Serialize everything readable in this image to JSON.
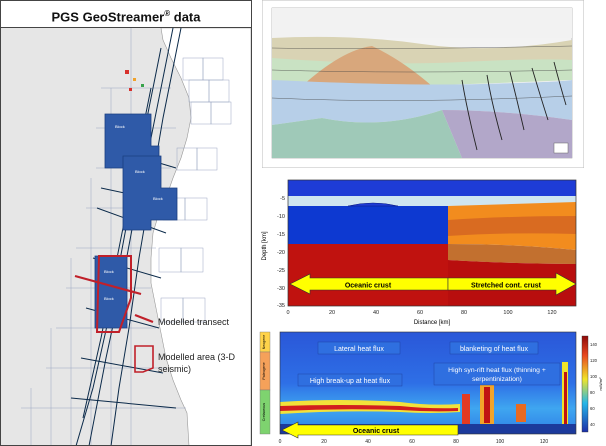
{
  "map": {
    "title_main": "PGS GeoStreamer",
    "title_sup": "®",
    "title_suffix": " data",
    "legend": {
      "transect": "Modelled transect",
      "area": "Modelled area (3-D seismic)"
    },
    "colors": {
      "blocks": "#2f5aa8",
      "transect": "#c0202a",
      "land": "#ffffff",
      "sea": "#e6e6e6",
      "lines": "#0b2a4a"
    }
  },
  "model": {
    "axis_x_label": "Distance [km]",
    "axis_y_label": "Depth [km]",
    "x_ticks": [
      "0",
      "20",
      "40",
      "60",
      "80",
      "100",
      "120"
    ],
    "y_ticks": [
      "-5",
      "-10",
      "-15",
      "-20",
      "-25",
      "-30",
      "-35"
    ],
    "arrow_left": "Oceanic crust",
    "arrow_right": "Stretched cont. crust"
  },
  "heat": {
    "label_lateral": "Lateral heat flux",
    "label_blanketing": "blanketing of heat flux",
    "label_synrift_1": "High syn-rift heat flux (thinning +",
    "label_synrift_2": "serpentinization)",
    "label_breakup": "High break-up at heat flux",
    "arrow_oceanic": "Oceanic crust",
    "x_ticks": [
      "0",
      "20",
      "40",
      "60",
      "80",
      "100",
      "120"
    ],
    "colorbar_ticks": [
      "140",
      "120",
      "100",
      "80",
      "60",
      "40"
    ],
    "colorbar_unit": "mW/m²",
    "side_labels": [
      "Neogene",
      "Paleogene",
      "Cretaceous"
    ]
  }
}
